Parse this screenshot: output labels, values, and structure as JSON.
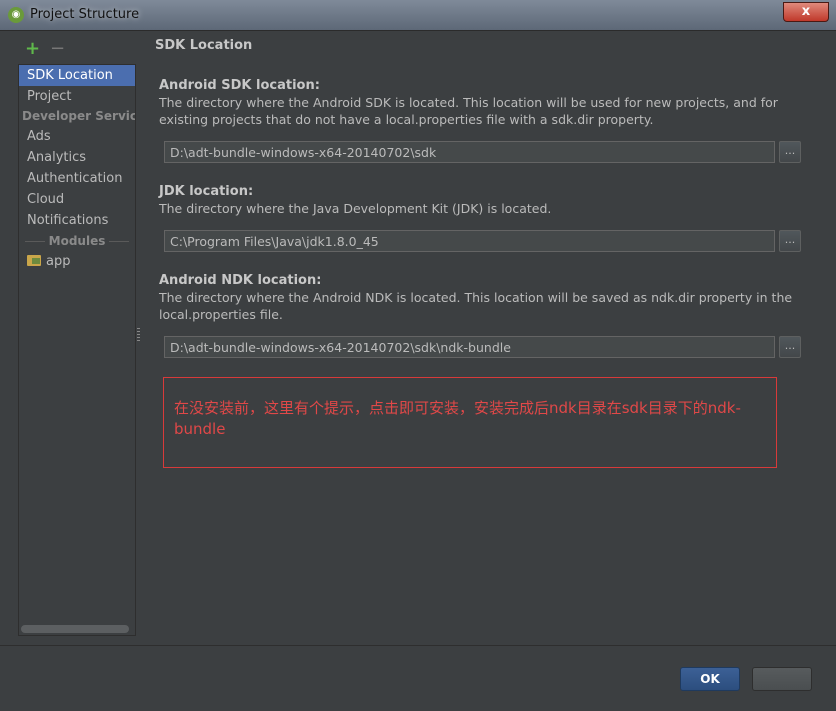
{
  "window": {
    "title": "Project Structure",
    "close_label": "x"
  },
  "toolbar": {
    "add_label": "+",
    "remove_label": "−"
  },
  "sidebar": {
    "items_top": [
      "SDK Location",
      "Project"
    ],
    "developer_header": "Developer Services",
    "services": [
      "Ads",
      "Analytics",
      "Authentication",
      "Cloud",
      "Notifications"
    ],
    "modules_header": "Modules",
    "modules": [
      "app"
    ]
  },
  "main": {
    "section_title": "SDK Location",
    "android_sdk": {
      "label": "Android SDK location:",
      "description": "The directory where the Android SDK is located. This location will be used for new projects, and for existing projects that do not have a local.properties file with a sdk.dir property.",
      "value": "D:\\adt-bundle-windows-x64-20140702\\sdk"
    },
    "jdk": {
      "label": "JDK location:",
      "description": "The directory where the Java Development Kit (JDK) is located.",
      "value": "C:\\Program Files\\Java\\jdk1.8.0_45"
    },
    "android_ndk": {
      "label": "Android NDK location:",
      "description": "The directory where the Android NDK is located. This location will be saved as ndk.dir property in the local.properties file.",
      "value": "D:\\adt-bundle-windows-x64-20140702\\sdk\\ndk-bundle"
    },
    "browse_label": "...",
    "annotation": "在没安装前，这里有个提示，点击即可安装，安装完成后ndk目录在sdk目录下的ndk-bundle"
  },
  "footer": {
    "ok_label": "OK",
    "cancel_label": ""
  },
  "colors": {
    "background": "#3c3f41",
    "selection": "#4b6eaf",
    "annotation": "#e04848",
    "add_icon": "#5fb84b"
  }
}
